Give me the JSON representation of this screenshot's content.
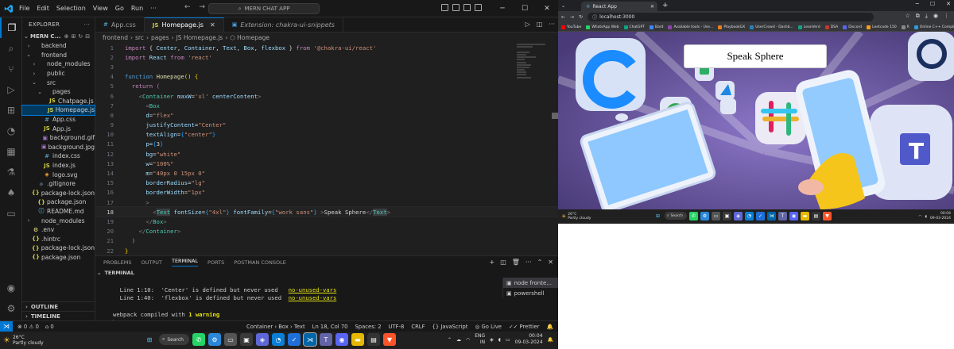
{
  "vscode": {
    "menu": [
      "File",
      "Edit",
      "Selection",
      "View",
      "Go",
      "Run",
      "···"
    ],
    "window_title": "MERN CHAT APP",
    "explorer_header": "EXPLORER",
    "project_name": "MERN C...",
    "tree": [
      {
        "label": "backend",
        "depth": 0,
        "chevron": "›",
        "icon": "",
        "color": "#ccc"
      },
      {
        "label": "frontend",
        "depth": 0,
        "chevron": "⌄",
        "icon": "",
        "color": "#ccc"
      },
      {
        "label": "node_modules",
        "depth": 1,
        "chevron": "›",
        "icon": "",
        "color": "#ccc"
      },
      {
        "label": "public",
        "depth": 1,
        "chevron": "›",
        "icon": "",
        "color": "#ccc"
      },
      {
        "label": "src",
        "depth": 1,
        "chevron": "⌄",
        "icon": "",
        "color": "#ccc"
      },
      {
        "label": "pages",
        "depth": 2,
        "chevron": "⌄",
        "icon": "",
        "color": "#ccc"
      },
      {
        "label": "Chatpage.js",
        "depth": 3,
        "chevron": "",
        "icon": "JS",
        "color": "#cbcb41"
      },
      {
        "label": "Homepage.js",
        "depth": 3,
        "chevron": "",
        "icon": "JS",
        "color": "#cbcb41",
        "selected": true
      },
      {
        "label": "App.css",
        "depth": 2,
        "chevron": "",
        "icon": "#",
        "color": "#519aba"
      },
      {
        "label": "App.js",
        "depth": 2,
        "chevron": "",
        "icon": "JS",
        "color": "#cbcb41"
      },
      {
        "label": "background.gif",
        "depth": 2,
        "chevron": "",
        "icon": "▣",
        "color": "#a074c4"
      },
      {
        "label": "background.jpg",
        "depth": 2,
        "chevron": "",
        "icon": "▣",
        "color": "#a074c4"
      },
      {
        "label": "index.css",
        "depth": 2,
        "chevron": "",
        "icon": "#",
        "color": "#519aba"
      },
      {
        "label": "index.js",
        "depth": 2,
        "chevron": "",
        "icon": "JS",
        "color": "#cbcb41"
      },
      {
        "label": "logo.svg",
        "depth": 2,
        "chevron": "",
        "icon": "◈",
        "color": "#ffb13b"
      },
      {
        "label": ".gitignore",
        "depth": 1,
        "chevron": "",
        "icon": "◆",
        "color": "#41535b"
      },
      {
        "label": "package-lock.json",
        "depth": 1,
        "chevron": "",
        "icon": "{}",
        "color": "#cbcb41"
      },
      {
        "label": "package.json",
        "depth": 1,
        "chevron": "",
        "icon": "{}",
        "color": "#cbcb41"
      },
      {
        "label": "README.md",
        "depth": 1,
        "chevron": "",
        "icon": "ⓘ",
        "color": "#519aba"
      },
      {
        "label": "node_modules",
        "depth": 0,
        "chevron": "›",
        "icon": "",
        "color": "#ccc"
      },
      {
        "label": ".env",
        "depth": 0,
        "chevron": "",
        "icon": "⚙",
        "color": "#faf594"
      },
      {
        "label": ".hintrc",
        "depth": 0,
        "chevron": "",
        "icon": "{}",
        "color": "#cbcb41"
      },
      {
        "label": "package-lock.json",
        "depth": 0,
        "chevron": "",
        "icon": "{}",
        "color": "#cbcb41"
      },
      {
        "label": "package.json",
        "depth": 0,
        "chevron": "",
        "icon": "{}",
        "color": "#cbcb41"
      }
    ],
    "outline_label": "OUTLINE",
    "timeline_label": "TIMELINE",
    "tabs": [
      {
        "label": "App.css",
        "icon": "#",
        "icon_color": "#519aba",
        "active": false,
        "italic": false
      },
      {
        "label": "Homepage.js",
        "icon": "JS",
        "icon_color": "#cbcb41",
        "active": true,
        "italic": false
      },
      {
        "label": "Extension: chakra-ui-snippets",
        "icon": "▣",
        "icon_color": "#4ea0e0",
        "active": false,
        "italic": true
      }
    ],
    "breadcrumb": [
      "frontend",
      "src",
      "pages",
      "JS Homepage.js",
      "⬡ Homepage"
    ],
    "current_line": 18,
    "code_lines": [
      [
        [
          "kw",
          "import"
        ],
        [
          "tx2",
          " { "
        ],
        [
          "vr",
          "Center"
        ],
        [
          "tx2",
          ", "
        ],
        [
          "vr",
          "Container"
        ],
        [
          "tx2",
          ", "
        ],
        [
          "vr",
          "Text"
        ],
        [
          "tx2",
          ", "
        ],
        [
          "vr",
          "Box"
        ],
        [
          "tx2",
          ", "
        ],
        [
          "vr",
          "flexbox"
        ],
        [
          "tx2",
          " } "
        ],
        [
          "kw",
          "from"
        ],
        [
          "tx2",
          " "
        ],
        [
          "st",
          "'@chakra-ui/react'"
        ]
      ],
      [
        [
          "kw",
          "import"
        ],
        [
          "tx2",
          " "
        ],
        [
          "vr",
          "React"
        ],
        [
          "tx2",
          " "
        ],
        [
          "kw",
          "from"
        ],
        [
          "tx2",
          " "
        ],
        [
          "st",
          "'react'"
        ]
      ],
      [],
      [
        [
          "kb",
          "function"
        ],
        [
          "tx2",
          " "
        ],
        [
          "fn",
          "Homepage"
        ],
        [
          "br1",
          "()"
        ],
        [
          "tx2",
          " "
        ],
        [
          "br1",
          "{"
        ]
      ],
      [
        [
          "tx2",
          "  "
        ],
        [
          "kw",
          "return"
        ],
        [
          "tx2",
          " "
        ],
        [
          "br2",
          "("
        ]
      ],
      [
        [
          "tx2",
          "    "
        ],
        [
          "pu",
          "<"
        ],
        [
          "tg",
          "Container"
        ],
        [
          "tx2",
          " "
        ],
        [
          "vr",
          "maxW"
        ],
        [
          "tx2",
          "="
        ],
        [
          "st",
          "'xl'"
        ],
        [
          "tx2",
          " "
        ],
        [
          "vr",
          "centerContent"
        ],
        [
          "pu",
          ">"
        ]
      ],
      [
        [
          "tx2",
          "      "
        ],
        [
          "pu",
          "<"
        ],
        [
          "tg",
          "Box"
        ]
      ],
      [
        [
          "tx2",
          "      "
        ],
        [
          "vr",
          "d"
        ],
        [
          "tx2",
          "="
        ],
        [
          "st",
          "\"flex\""
        ]
      ],
      [
        [
          "tx2",
          "      "
        ],
        [
          "vr",
          "justifyContent"
        ],
        [
          "tx2",
          "="
        ],
        [
          "st",
          "\"Center\""
        ]
      ],
      [
        [
          "tx2",
          "      "
        ],
        [
          "vr",
          "textAlign"
        ],
        [
          "tx2",
          "="
        ],
        [
          "br3",
          "{"
        ],
        [
          "st",
          "\"center\""
        ],
        [
          "br3",
          "}"
        ]
      ],
      [
        [
          "tx2",
          "      "
        ],
        [
          "vr",
          "p"
        ],
        [
          "tx2",
          "="
        ],
        [
          "br3",
          "{"
        ],
        [
          "tx2",
          "3"
        ],
        [
          "br3",
          "}"
        ]
      ],
      [
        [
          "tx2",
          "      "
        ],
        [
          "vr",
          "bg"
        ],
        [
          "tx2",
          "="
        ],
        [
          "st",
          "\"white\""
        ]
      ],
      [
        [
          "tx2",
          "      "
        ],
        [
          "vr",
          "w"
        ],
        [
          "tx2",
          "="
        ],
        [
          "st",
          "\"100%\""
        ]
      ],
      [
        [
          "tx2",
          "      "
        ],
        [
          "vr",
          "m"
        ],
        [
          "tx2",
          "="
        ],
        [
          "st",
          "\"40px 0 15px 0\""
        ]
      ],
      [
        [
          "tx2",
          "      "
        ],
        [
          "vr",
          "borderRadius"
        ],
        [
          "tx2",
          "="
        ],
        [
          "st",
          "\"lg\""
        ]
      ],
      [
        [
          "tx2",
          "      "
        ],
        [
          "vr",
          "borderWidth"
        ],
        [
          "tx2",
          "="
        ],
        [
          "st",
          "\"1px\""
        ]
      ],
      [
        [
          "tx2",
          "      "
        ],
        [
          "pu",
          ">"
        ]
      ],
      [
        [
          "tx2",
          "        "
        ],
        [
          "pu",
          "<"
        ],
        [
          "tgh",
          "Text"
        ],
        [
          "tx2",
          " "
        ],
        [
          "vr",
          "fontSize"
        ],
        [
          "tx2",
          "="
        ],
        [
          "br3",
          "{"
        ],
        [
          "st",
          "\"4xl\""
        ],
        [
          "br3",
          "}"
        ],
        [
          "tx2",
          " "
        ],
        [
          "vr",
          "fontFamily"
        ],
        [
          "tx2",
          "="
        ],
        [
          "br3",
          "{"
        ],
        [
          "st",
          "\"work sans\""
        ],
        [
          "br3",
          "}"
        ],
        [
          "tx2",
          " "
        ],
        [
          "pu",
          ">"
        ],
        [
          "tx2",
          "Speak Sphere"
        ],
        [
          "pu",
          "</"
        ],
        [
          "tgh",
          "Text"
        ],
        [
          "pu",
          ">"
        ]
      ],
      [
        [
          "tx2",
          "      "
        ],
        [
          "pu",
          "</"
        ],
        [
          "tg",
          "Box"
        ],
        [
          "pu",
          ">"
        ]
      ],
      [
        [
          "tx2",
          "    "
        ],
        [
          "pu",
          "</"
        ],
        [
          "tg",
          "Container"
        ],
        [
          "pu",
          ">"
        ]
      ],
      [
        [
          "tx2",
          "  "
        ],
        [
          "br2",
          ")"
        ]
      ],
      [
        [
          "br1",
          "}"
        ]
      ],
      [],
      [
        [
          "kw",
          "export"
        ],
        [
          "tx2",
          " "
        ],
        [
          "kw",
          "default"
        ],
        [
          "tx2",
          " "
        ],
        [
          "fn",
          "Homepage"
        ]
      ]
    ],
    "panel_tabs": [
      "PROBLEMS",
      "OUTPUT",
      "TERMINAL",
      "PORTS",
      "POSTMAN CONSOLE"
    ],
    "panel_active": "TERMINAL",
    "terminal_header": "TERMINAL",
    "terminal_lines": [
      {
        "pre": "",
        "txt": ""
      },
      {
        "pre": "  Line 1:10:  'Center' is defined but never used   ",
        "rule": "no-unused-vars"
      },
      {
        "pre": "  Line 1:40:  'flexbox' is defined but never used  ",
        "rule": "no-unused-vars"
      },
      {
        "pre": "",
        "txt": ""
      },
      {
        "pre": "webpack compiled with ",
        "bold": "1 warning"
      },
      {
        "pre": "▏",
        "txt": ""
      }
    ],
    "terminals": [
      {
        "label": "node  fronte...",
        "active": true
      },
      {
        "label": "powershell",
        "active": false
      }
    ],
    "status_left": [
      "⊗ 0  ⚠ 0",
      "⌂ 0"
    ],
    "status_right": [
      "Container › Box › Text",
      "Ln 18, Col 70",
      "Spaces: 2",
      "UTF-8",
      "CRLF",
      "{} JavaScript",
      "◎ Go Live",
      "✓✓ Prettier",
      "🔔"
    ]
  },
  "taskbar": {
    "temp": "26°C",
    "weather": "Partly cloudy",
    "search": "Search",
    "lang1": "ENG",
    "lang2": "IN",
    "time": "00:04",
    "date": "09-03-2024"
  },
  "browser": {
    "tab_title": "React App",
    "url": "localhost:3000",
    "bookmarks": [
      "YouTube",
      "WhatsApp Web",
      "ChatGPT",
      "Bard",
      "Available tools - Use...",
      "PlaybookGX",
      "UserCrowd - Dashb...",
      "LeanVerd",
      "DSA",
      "Discord",
      "Leetcode 150",
      "R",
      "Online C++ Compil..."
    ],
    "card_text": "Speak Sphere",
    "taskbar_temp": "26°C",
    "taskbar_weather": "Partly cloudy",
    "taskbar_search": "Search",
    "taskbar_time": "00:04",
    "taskbar_date": "09-03-2024"
  }
}
